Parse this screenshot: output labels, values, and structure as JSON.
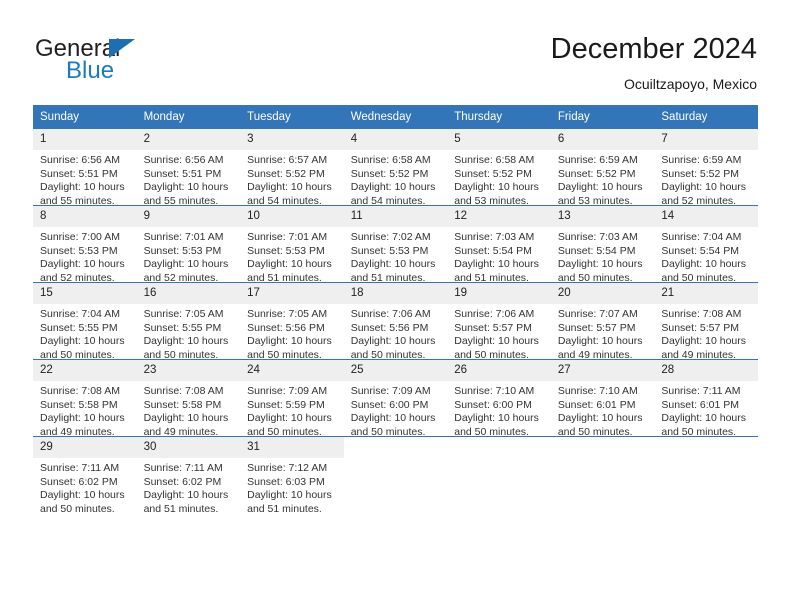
{
  "brand": {
    "name_top": "General",
    "name_bottom": "Blue",
    "triangle_color": "#1c6fb5",
    "text_color": "#231f20",
    "blue_color": "#1c7ac0"
  },
  "header": {
    "title": "December 2024",
    "subtitle": "Ocuiltzapoyo, Mexico"
  },
  "theme": {
    "header_bg": "#3275b8",
    "header_text": "#ffffff",
    "daynum_bg": "#efefef",
    "row_divider": "#3275b8"
  },
  "weekdays": [
    "Sunday",
    "Monday",
    "Tuesday",
    "Wednesday",
    "Thursday",
    "Friday",
    "Saturday"
  ],
  "labels": {
    "sunrise_prefix": "Sunrise:",
    "sunset_prefix": "Sunset:",
    "daylight_prefix": "Daylight:"
  },
  "weeks": [
    [
      {
        "day": "1",
        "sunrise": "Sunrise: 6:56 AM",
        "sunset": "Sunset: 5:51 PM",
        "daylight": "Daylight: 10 hours and 55 minutes."
      },
      {
        "day": "2",
        "sunrise": "Sunrise: 6:56 AM",
        "sunset": "Sunset: 5:51 PM",
        "daylight": "Daylight: 10 hours and 55 minutes."
      },
      {
        "day": "3",
        "sunrise": "Sunrise: 6:57 AM",
        "sunset": "Sunset: 5:52 PM",
        "daylight": "Daylight: 10 hours and 54 minutes."
      },
      {
        "day": "4",
        "sunrise": "Sunrise: 6:58 AM",
        "sunset": "Sunset: 5:52 PM",
        "daylight": "Daylight: 10 hours and 54 minutes."
      },
      {
        "day": "5",
        "sunrise": "Sunrise: 6:58 AM",
        "sunset": "Sunset: 5:52 PM",
        "daylight": "Daylight: 10 hours and 53 minutes."
      },
      {
        "day": "6",
        "sunrise": "Sunrise: 6:59 AM",
        "sunset": "Sunset: 5:52 PM",
        "daylight": "Daylight: 10 hours and 53 minutes."
      },
      {
        "day": "7",
        "sunrise": "Sunrise: 6:59 AM",
        "sunset": "Sunset: 5:52 PM",
        "daylight": "Daylight: 10 hours and 52 minutes."
      }
    ],
    [
      {
        "day": "8",
        "sunrise": "Sunrise: 7:00 AM",
        "sunset": "Sunset: 5:53 PM",
        "daylight": "Daylight: 10 hours and 52 minutes."
      },
      {
        "day": "9",
        "sunrise": "Sunrise: 7:01 AM",
        "sunset": "Sunset: 5:53 PM",
        "daylight": "Daylight: 10 hours and 52 minutes."
      },
      {
        "day": "10",
        "sunrise": "Sunrise: 7:01 AM",
        "sunset": "Sunset: 5:53 PM",
        "daylight": "Daylight: 10 hours and 51 minutes."
      },
      {
        "day": "11",
        "sunrise": "Sunrise: 7:02 AM",
        "sunset": "Sunset: 5:53 PM",
        "daylight": "Daylight: 10 hours and 51 minutes."
      },
      {
        "day": "12",
        "sunrise": "Sunrise: 7:03 AM",
        "sunset": "Sunset: 5:54 PM",
        "daylight": "Daylight: 10 hours and 51 minutes."
      },
      {
        "day": "13",
        "sunrise": "Sunrise: 7:03 AM",
        "sunset": "Sunset: 5:54 PM",
        "daylight": "Daylight: 10 hours and 50 minutes."
      },
      {
        "day": "14",
        "sunrise": "Sunrise: 7:04 AM",
        "sunset": "Sunset: 5:54 PM",
        "daylight": "Daylight: 10 hours and 50 minutes."
      }
    ],
    [
      {
        "day": "15",
        "sunrise": "Sunrise: 7:04 AM",
        "sunset": "Sunset: 5:55 PM",
        "daylight": "Daylight: 10 hours and 50 minutes."
      },
      {
        "day": "16",
        "sunrise": "Sunrise: 7:05 AM",
        "sunset": "Sunset: 5:55 PM",
        "daylight": "Daylight: 10 hours and 50 minutes."
      },
      {
        "day": "17",
        "sunrise": "Sunrise: 7:05 AM",
        "sunset": "Sunset: 5:56 PM",
        "daylight": "Daylight: 10 hours and 50 minutes."
      },
      {
        "day": "18",
        "sunrise": "Sunrise: 7:06 AM",
        "sunset": "Sunset: 5:56 PM",
        "daylight": "Daylight: 10 hours and 50 minutes."
      },
      {
        "day": "19",
        "sunrise": "Sunrise: 7:06 AM",
        "sunset": "Sunset: 5:57 PM",
        "daylight": "Daylight: 10 hours and 50 minutes."
      },
      {
        "day": "20",
        "sunrise": "Sunrise: 7:07 AM",
        "sunset": "Sunset: 5:57 PM",
        "daylight": "Daylight: 10 hours and 49 minutes."
      },
      {
        "day": "21",
        "sunrise": "Sunrise: 7:08 AM",
        "sunset": "Sunset: 5:57 PM",
        "daylight": "Daylight: 10 hours and 49 minutes."
      }
    ],
    [
      {
        "day": "22",
        "sunrise": "Sunrise: 7:08 AM",
        "sunset": "Sunset: 5:58 PM",
        "daylight": "Daylight: 10 hours and 49 minutes."
      },
      {
        "day": "23",
        "sunrise": "Sunrise: 7:08 AM",
        "sunset": "Sunset: 5:58 PM",
        "daylight": "Daylight: 10 hours and 49 minutes."
      },
      {
        "day": "24",
        "sunrise": "Sunrise: 7:09 AM",
        "sunset": "Sunset: 5:59 PM",
        "daylight": "Daylight: 10 hours and 50 minutes."
      },
      {
        "day": "25",
        "sunrise": "Sunrise: 7:09 AM",
        "sunset": "Sunset: 6:00 PM",
        "daylight": "Daylight: 10 hours and 50 minutes."
      },
      {
        "day": "26",
        "sunrise": "Sunrise: 7:10 AM",
        "sunset": "Sunset: 6:00 PM",
        "daylight": "Daylight: 10 hours and 50 minutes."
      },
      {
        "day": "27",
        "sunrise": "Sunrise: 7:10 AM",
        "sunset": "Sunset: 6:01 PM",
        "daylight": "Daylight: 10 hours and 50 minutes."
      },
      {
        "day": "28",
        "sunrise": "Sunrise: 7:11 AM",
        "sunset": "Sunset: 6:01 PM",
        "daylight": "Daylight: 10 hours and 50 minutes."
      }
    ],
    [
      {
        "day": "29",
        "sunrise": "Sunrise: 7:11 AM",
        "sunset": "Sunset: 6:02 PM",
        "daylight": "Daylight: 10 hours and 50 minutes."
      },
      {
        "day": "30",
        "sunrise": "Sunrise: 7:11 AM",
        "sunset": "Sunset: 6:02 PM",
        "daylight": "Daylight: 10 hours and 51 minutes."
      },
      {
        "day": "31",
        "sunrise": "Sunrise: 7:12 AM",
        "sunset": "Sunset: 6:03 PM",
        "daylight": "Daylight: 10 hours and 51 minutes."
      },
      {
        "day": "",
        "sunrise": "",
        "sunset": "",
        "daylight": ""
      },
      {
        "day": "",
        "sunrise": "",
        "sunset": "",
        "daylight": ""
      },
      {
        "day": "",
        "sunrise": "",
        "sunset": "",
        "daylight": ""
      },
      {
        "day": "",
        "sunrise": "",
        "sunset": "",
        "daylight": ""
      }
    ]
  ]
}
